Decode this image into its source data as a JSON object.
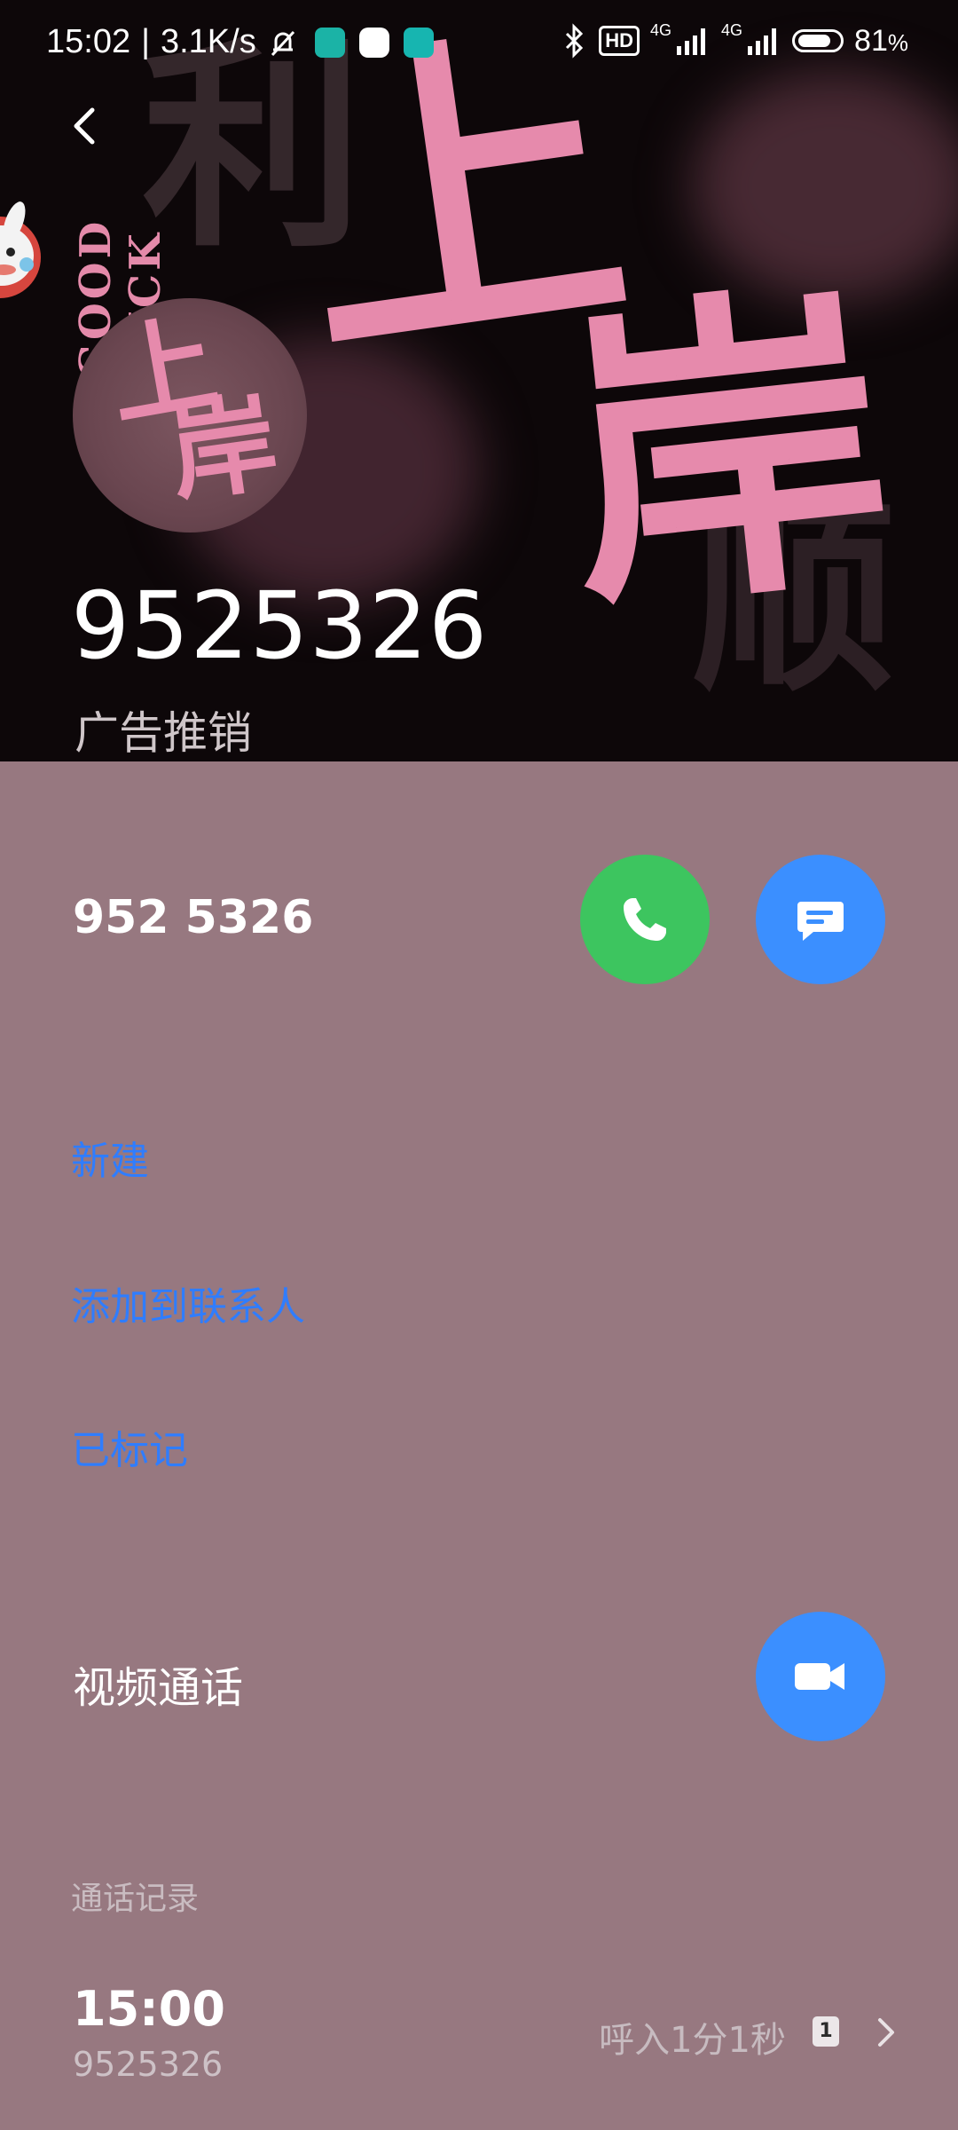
{
  "status_bar": {
    "time": "15:02",
    "net_speed": "3.1K/s",
    "hd_label": "HD",
    "signal_1_label": "4G",
    "signal_2_label": "4G",
    "battery": "81",
    "battery_unit": "%",
    "battery_level": 0.81
  },
  "header": {
    "bg_text_1": "利",
    "bg_text_2": "顺",
    "bg_vertical_text": "GOOD LUCK",
    "art_text_1": "上",
    "art_text_2": "岸",
    "avatar_text_1": "上",
    "avatar_text_2": "岸",
    "number": "9525326",
    "tag": "广告推销"
  },
  "number_row": {
    "formatted_number": "952 5326"
  },
  "actions": {
    "new": "新建",
    "add_to_contacts": "添加到联系人",
    "marked": "已标记"
  },
  "video_call": {
    "label": "视频通话"
  },
  "call_history": {
    "header": "通话记录",
    "entries": [
      {
        "time": "15:00",
        "number": "9525326",
        "type": "呼入1分1秒",
        "sim": "1"
      }
    ]
  },
  "colors": {
    "body_bg": "#977880",
    "hero_bg": "#0d0709",
    "accent_pink": "#e68aac",
    "call_green": "#3dc55f",
    "action_blue": "#3b8fff",
    "link_blue": "#2f7dff"
  },
  "icons": {
    "back": "chevron-left-icon",
    "call": "phone-icon",
    "message": "message-icon",
    "video": "video-camera-icon",
    "detail": "chevron-right-icon"
  }
}
